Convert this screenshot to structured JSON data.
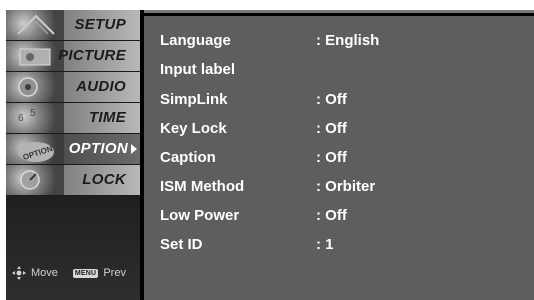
{
  "menu": {
    "items": [
      {
        "label": "SETUP"
      },
      {
        "label": "PICTURE"
      },
      {
        "label": "AUDIO"
      },
      {
        "label": "TIME"
      },
      {
        "label": "OPTION",
        "active": true
      },
      {
        "label": "LOCK"
      }
    ],
    "thumb_text": {
      "option": "OPTION"
    }
  },
  "footer": {
    "move_label": "Move",
    "menu_key": "MENU",
    "prev_label": "Prev"
  },
  "options": [
    {
      "name": "Language",
      "value": ": English"
    },
    {
      "name": "Input label",
      "value": ""
    },
    {
      "name": "SimpLink",
      "value": ": Off"
    },
    {
      "name": "Key Lock",
      "value": ": Off"
    },
    {
      "name": "Caption",
      "value": ": Off"
    },
    {
      "name": "ISM Method",
      "value": ": Orbiter"
    },
    {
      "name": "Low Power",
      "value": ": Off"
    },
    {
      "name": "Set ID",
      "value": ": 1"
    }
  ],
  "colors": {
    "panel": "#5e5e5e",
    "active_label": "#ffffff",
    "label": "#1c1c1c"
  }
}
